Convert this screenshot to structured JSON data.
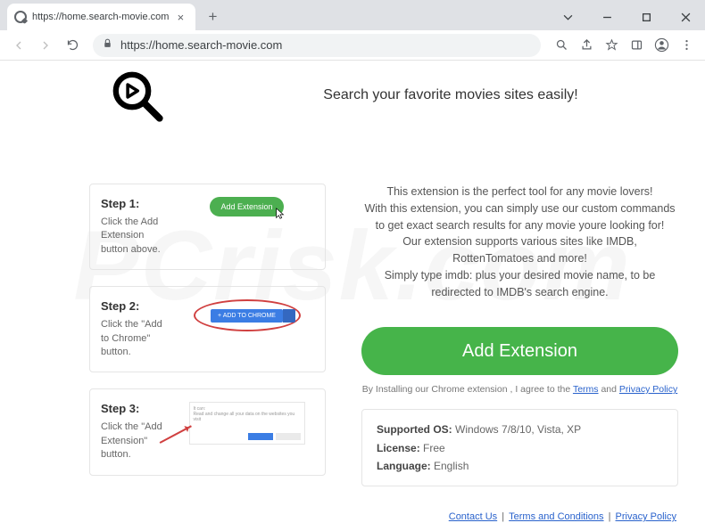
{
  "browser": {
    "url": "https://home.search-movie.com",
    "tab_title": "https://home.search-movie.com"
  },
  "page": {
    "headline": "Search your favorite movies sites easily!",
    "description": "This extension is the perfect tool for any movie lovers!\nWith this extension, you can simply use our custom commands to get exact search results for any movie youre looking for!\nOur extension supports various sites like IMDB, RottenTomatoes and more!\nSimply type imdb: plus your desired movie name, to be redirected to IMDB's search engine.",
    "big_button": "Add Extension",
    "agree_prefix": "By Installing our Chrome extension , I agree to the ",
    "terms_link": "Terms",
    "agree_and": " and ",
    "privacy_link": "Privacy Policy",
    "info": {
      "os_label": "Supported OS:",
      "os_value": " Windows 7/8/10, Vista, XP",
      "license_label": "License:",
      "license_value": " Free",
      "lang_label": "Language:",
      "lang_value": " English"
    }
  },
  "steps": {
    "s1": {
      "title": "Step 1:",
      "desc": "Click the Add Extension button above.",
      "pill": "Add Extension"
    },
    "s2": {
      "title": "Step 2:",
      "desc": "Click the \"Add to Chrome\" button.",
      "btn": "+  ADD TO CHROME"
    },
    "s3": {
      "title": "Step 3:",
      "desc": "Click the \"Add Extension\" button."
    }
  },
  "footer": {
    "contact": "Contact Us",
    "terms": "Terms and Conditions",
    "privacy": "Privacy Policy"
  }
}
